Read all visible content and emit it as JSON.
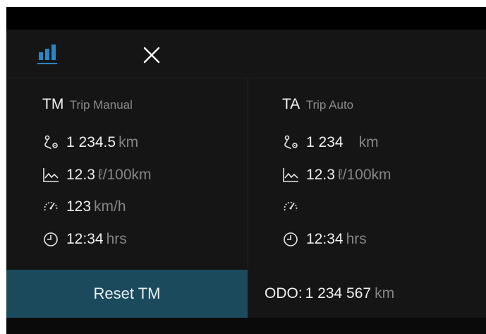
{
  "colors": {
    "accent": "#2a86c6",
    "reset_button_bg": "#1c4a5d",
    "background": "#151515"
  },
  "toolbar": {
    "stats_icon": "bar-chart-icon",
    "close_icon": "close-icon"
  },
  "trip_manual": {
    "code": "TM",
    "name": "Trip Manual",
    "distance": {
      "icon": "route-icon",
      "value": "1 234.5",
      "unit": "km"
    },
    "consumption": {
      "icon": "consumption-chart-icon",
      "value": "12.3",
      "unit": "ℓ/100km"
    },
    "speed": {
      "icon": "speedometer-icon",
      "value": "123",
      "unit": "km/h"
    },
    "time": {
      "icon": "clock-icon",
      "value": "12:34",
      "unit": "hrs"
    }
  },
  "trip_auto": {
    "code": "TA",
    "name": "Trip Auto",
    "distance": {
      "icon": "route-icon",
      "value": "1 234",
      "unit": "km"
    },
    "consumption": {
      "icon": "consumption-chart-icon",
      "value": "12.3",
      "unit": "ℓ/100km"
    },
    "speed": {
      "icon": "speedometer-icon"
    },
    "time": {
      "icon": "clock-icon",
      "value": "12:34",
      "unit": "hrs"
    }
  },
  "reset_button": {
    "label": "Reset TM"
  },
  "odometer": {
    "label": "ODO:",
    "value": "1 234 567",
    "unit": "km"
  }
}
